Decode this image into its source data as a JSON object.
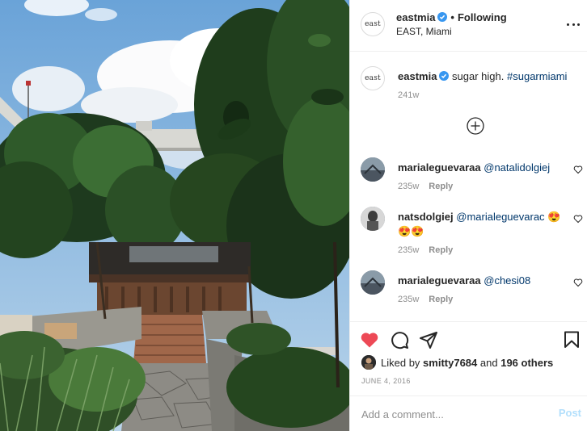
{
  "post": {
    "username": "eastmia",
    "avatar_text": "east",
    "follow_status": "Following",
    "separator": "•",
    "location": "EAST, Miami"
  },
  "caption": {
    "username": "eastmia",
    "text": "sugar high.",
    "hashtag": "#sugarmiami",
    "age": "241w"
  },
  "comments": [
    {
      "username": "marialeguevaraa",
      "mention": "@natalidolgiej",
      "text": "",
      "age": "235w",
      "reply_label": "Reply"
    },
    {
      "username": "natsdolgiej",
      "mention": "@marialeguevarac",
      "text": "😍😍😍",
      "age": "235w",
      "reply_label": "Reply"
    },
    {
      "username": "marialeguevaraa",
      "mention": "@chesi08",
      "text": "",
      "age": "235w",
      "reply_label": "Reply"
    }
  ],
  "likes": {
    "prefix": "Liked by",
    "user": "smitty7684",
    "conjunction": "and",
    "others": "196 others"
  },
  "date": "JUNE 4, 2016",
  "comment_box": {
    "placeholder": "Add a comment...",
    "post_label": "Post"
  },
  "colors": {
    "like_red": "#ed4956",
    "verified_blue": "#3897f0",
    "link": "#00376b",
    "post_disabled": "#b2dffc"
  },
  "icons": {
    "more": "more-icon",
    "verified": "verified-badge-icon",
    "load_more": "plus-circle-icon",
    "like": "heart-icon",
    "comment": "comment-icon",
    "share": "share-icon",
    "save": "bookmark-icon"
  }
}
